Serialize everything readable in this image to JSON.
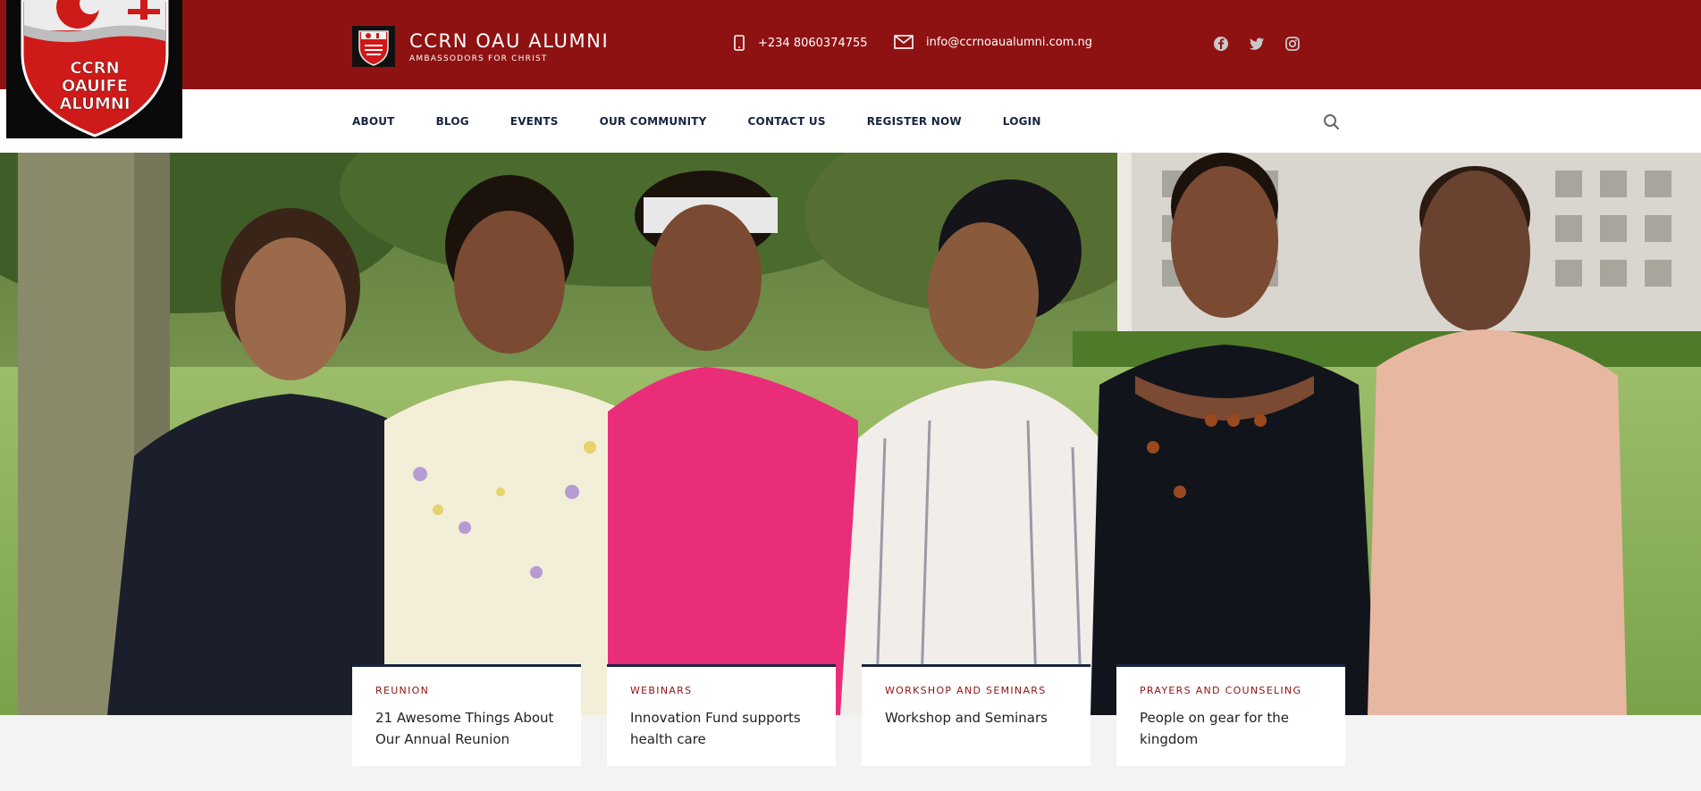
{
  "brand": {
    "title": "CCRN OAU ALUMNI",
    "subtitle": "AMBASSODORS FOR CHRIST",
    "logo_text": [
      "CCRN",
      "OAUIFE",
      "ALUMNI"
    ]
  },
  "contact": {
    "phone": "+234 8060374755",
    "email": "info@ccrnoaualumni.com.ng"
  },
  "socials": [
    "facebook-icon",
    "twitter-icon",
    "instagram-icon"
  ],
  "nav": {
    "items": [
      "ABOUT",
      "BLOG",
      "EVENTS",
      "OUR COMMUNITY",
      "CONTACT US",
      "REGISTER NOW",
      "LOGIN"
    ]
  },
  "cards": [
    {
      "category": "REUNION",
      "title": "21 Awesome Things About Our Annual Reunion"
    },
    {
      "category": "WEBINARS",
      "title": "Innovation Fund supports health care"
    },
    {
      "category": "WORKSHOP AND SEMINARS",
      "title": "Workshop and Seminars"
    },
    {
      "category": "PRAYERS AND COUNSELING",
      "title": "People on gear for the kingdom"
    }
  ],
  "colors": {
    "topbar": "#8f1212",
    "nav_text": "#17243f",
    "card_category": "#8f1212"
  }
}
